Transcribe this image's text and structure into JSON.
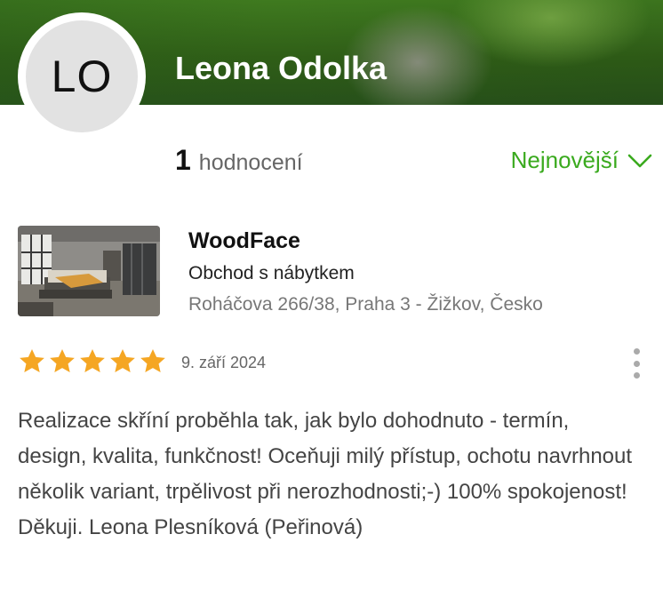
{
  "profile": {
    "initials": "LO",
    "name": "Leona Odolka"
  },
  "summary": {
    "count": "1",
    "count_label": "hodnocení",
    "sort_label": "Nejnovější"
  },
  "company": {
    "name": "WoodFace",
    "type": "Obchod s nábytkem",
    "address": "Roháčova 266/38, Praha 3 - Žižkov, Česko"
  },
  "review": {
    "rating": 5,
    "max_rating": 5,
    "date": "9. září 2024",
    "text": "Realizace skříní proběhla tak, jak bylo dohodnuto - termín, design, kvalita, funkčnost! Oceňuji milý přístup, ochotu navrhnout několik variant, trpělivost při nerozhodnosti;-) 100% spokojenost! Děkuji. Leona Plesníková (Peřinová)"
  },
  "colors": {
    "accent_green": "#3aaa1e",
    "star": "#f5a623",
    "banner_green": "#2f5e17"
  },
  "icons": {
    "sort": "chevron-down-icon",
    "more": "more-vertical-icon",
    "star": "star-icon"
  }
}
